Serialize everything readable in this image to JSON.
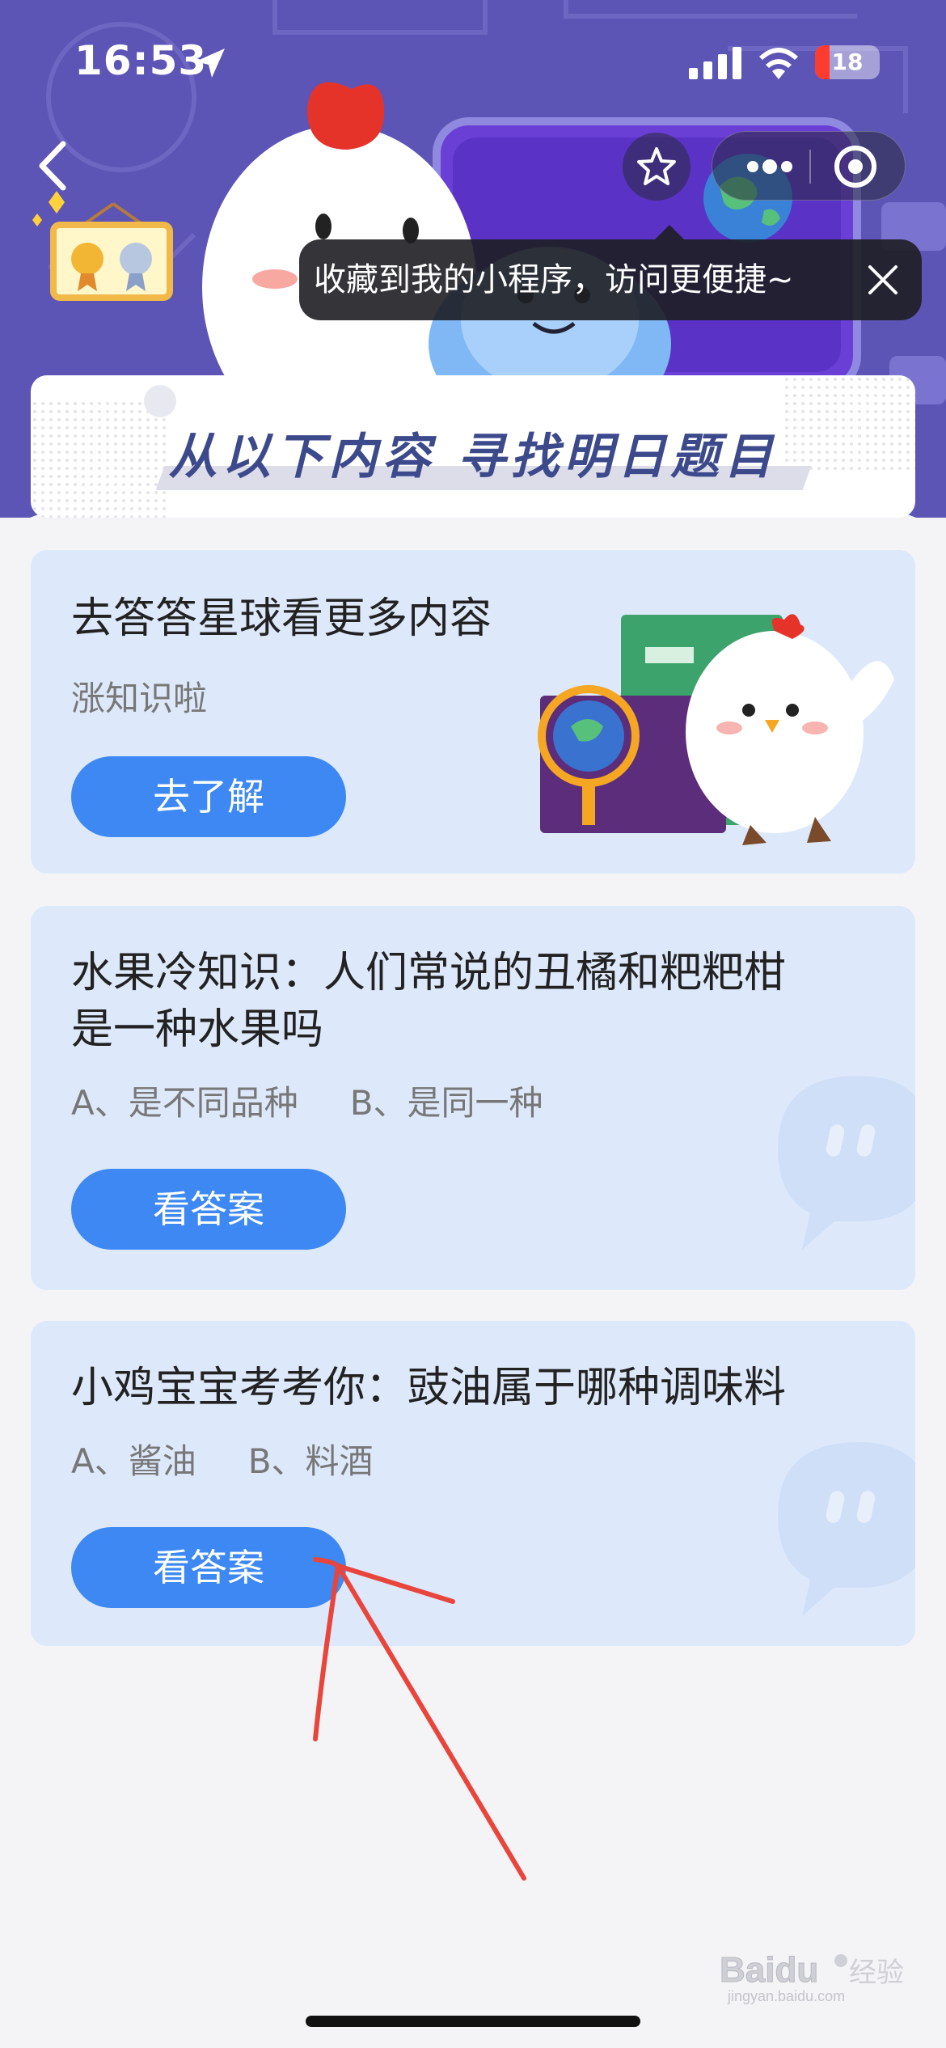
{
  "status_bar": {
    "time": "16:53",
    "battery": "18"
  },
  "tooltip": {
    "text": "收藏到我的小程序，访问更便捷~"
  },
  "title_strip": {
    "text": "从以下内容  寻找明日题目"
  },
  "cards": [
    {
      "title": "去答答星球看更多内容",
      "subtitle": "涨知识啦",
      "button": "去了解"
    },
    {
      "title_line1": "水果冷知识：人们常说的丑橘和粑粑柑",
      "title_line2": "是一种水果吗",
      "option_a": "A、是不同品种",
      "option_b": "B、是同一种",
      "button": "看答案"
    },
    {
      "title": "小鸡宝宝考考你：豉油属于哪种调味料",
      "option_a": "A、酱油",
      "option_b": "B、料酒",
      "button": "看答案"
    }
  ],
  "watermark": {
    "brand": "Baidu",
    "cn": "经验",
    "url": "jingyan.baidu.com"
  },
  "colors": {
    "banner": "#5c55b5",
    "card_bg": "#dde9fb",
    "button": "#3d88f2",
    "title_text": "#3c4a8c",
    "annotation": "#e8453c"
  }
}
